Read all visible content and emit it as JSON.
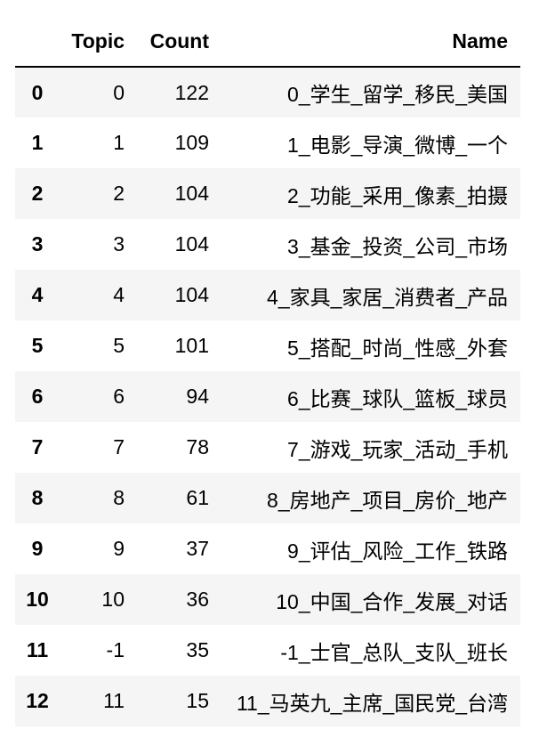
{
  "table": {
    "columns": [
      "",
      "Topic",
      "Count",
      "Name"
    ],
    "rows": [
      {
        "index": "0",
        "topic": "0",
        "count": "122",
        "name": "0_学生_留学_移民_美国"
      },
      {
        "index": "1",
        "topic": "1",
        "count": "109",
        "name": "1_电影_导演_微博_一个"
      },
      {
        "index": "2",
        "topic": "2",
        "count": "104",
        "name": "2_功能_采用_像素_拍摄"
      },
      {
        "index": "3",
        "topic": "3",
        "count": "104",
        "name": "3_基金_投资_公司_市场"
      },
      {
        "index": "4",
        "topic": "4",
        "count": "104",
        "name": "4_家具_家居_消费者_产品"
      },
      {
        "index": "5",
        "topic": "5",
        "count": "101",
        "name": "5_搭配_时尚_性感_外套"
      },
      {
        "index": "6",
        "topic": "6",
        "count": "94",
        "name": "6_比赛_球队_篮板_球员"
      },
      {
        "index": "7",
        "topic": "7",
        "count": "78",
        "name": "7_游戏_玩家_活动_手机"
      },
      {
        "index": "8",
        "topic": "8",
        "count": "61",
        "name": "8_房地产_项目_房价_地产"
      },
      {
        "index": "9",
        "topic": "9",
        "count": "37",
        "name": "9_评估_风险_工作_铁路"
      },
      {
        "index": "10",
        "topic": "10",
        "count": "36",
        "name": "10_中国_合作_发展_对话"
      },
      {
        "index": "11",
        "topic": "-1",
        "count": "35",
        "name": "-1_士官_总队_支队_班长"
      },
      {
        "index": "12",
        "topic": "11",
        "count": "15",
        "name": "11_马英九_主席_国民党_台湾"
      }
    ]
  }
}
